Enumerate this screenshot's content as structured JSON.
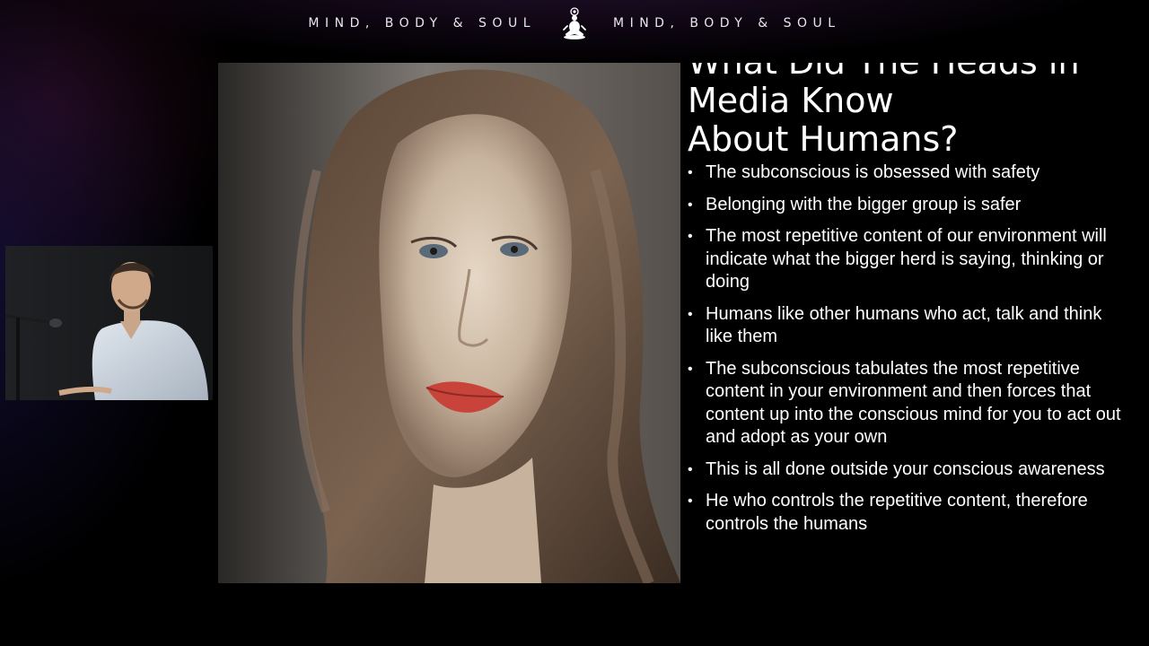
{
  "header": {
    "brand_left": "MIND, BODY & SOUL",
    "brand_right": "MIND, BODY & SOUL",
    "logo_icon": "meditation-figure-icon"
  },
  "slide": {
    "title_partial_line": "What Did The Heads in",
    "title_lines": [
      "Media Know",
      "About Humans?"
    ],
    "bullets": [
      "The subconscious is obsessed with safety",
      "Belonging with the bigger group is safer",
      "The most repetitive content of our environment will indicate what the bigger herd is saying, thinking or doing",
      "Humans like other humans who act, talk and think like them",
      "The subconscious tabulates the most repetitive content in your environment and then forces that content up into the conscious mind for you to act out and adopt as your own",
      "This is all done outside your conscious awareness",
      "He who controls the repetitive content, therefore controls the humans"
    ],
    "bullet_symbol": "•"
  },
  "colors": {
    "background": "#000000",
    "text": "#ffffff",
    "glow_purple": "#462a5a"
  }
}
